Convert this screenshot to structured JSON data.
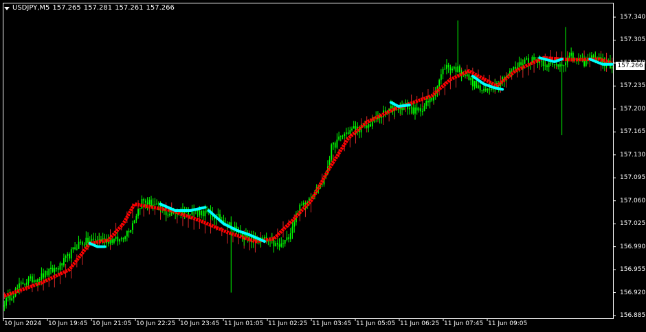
{
  "header": {
    "menu_icon": "triangle-down-icon",
    "symbol_timeframe": "USDJPY,M5",
    "open": "157.265",
    "high": "157.281",
    "low": "157.261",
    "close": "157.266"
  },
  "current_price": "157.266",
  "colors": {
    "background": "#000000",
    "axis": "#ffffff",
    "candle": "#00ff00",
    "ma_up": "#ff0000",
    "ma_down": "#00ffff",
    "ma_fan": "#ff3030"
  },
  "chart_data": {
    "type": "candlestick",
    "symbol": "USDJPY",
    "timeframe": "M5",
    "ylim": [
      156.885,
      157.365
    ],
    "y_ticks": [
      "157.340",
      "157.305",
      "157.270",
      "157.235",
      "157.200",
      "157.165",
      "157.130",
      "157.095",
      "157.060",
      "157.025",
      "156.990",
      "156.955",
      "156.920",
      "156.885"
    ],
    "x_ticks": [
      "10 Jun 2024",
      "10 Jun 19:45",
      "10 Jun 21:05",
      "10 Jun 22:25",
      "10 Jun 23:45",
      "11 Jun 01:05",
      "11 Jun 02:25",
      "11 Jun 03:45",
      "11 Jun 05:05",
      "11 Jun 06:25",
      "11 Jun 07:45",
      "11 Jun 09:05"
    ],
    "close_path": [
      [
        0,
        156.905
      ],
      [
        10,
        156.935
      ],
      [
        20,
        156.945
      ],
      [
        30,
        156.96
      ],
      [
        40,
        156.995
      ],
      [
        48,
        157.0
      ],
      [
        55,
        157.0
      ],
      [
        62,
        157.0
      ],
      [
        68,
        157.02
      ],
      [
        74,
        157.06
      ],
      [
        80,
        157.055
      ],
      [
        88,
        157.04
      ],
      [
        95,
        157.045
      ],
      [
        102,
        157.045
      ],
      [
        110,
        157.04
      ],
      [
        118,
        157.03
      ],
      [
        125,
        157.015
      ],
      [
        132,
        157.0
      ],
      [
        140,
        157.0
      ],
      [
        148,
        156.99
      ],
      [
        152,
        157.0
      ],
      [
        158,
        157.045
      ],
      [
        162,
        157.06
      ],
      [
        167,
        157.075
      ],
      [
        172,
        157.09
      ],
      [
        176,
        157.14
      ],
      [
        182,
        157.16
      ],
      [
        188,
        157.17
      ],
      [
        194,
        157.17
      ],
      [
        200,
        157.185
      ],
      [
        208,
        157.2
      ],
      [
        216,
        157.205
      ],
      [
        222,
        157.195
      ],
      [
        230,
        157.215
      ],
      [
        237,
        157.265
      ],
      [
        245,
        157.26
      ],
      [
        252,
        157.24
      ],
      [
        258,
        157.225
      ],
      [
        265,
        157.24
      ],
      [
        272,
        157.255
      ],
      [
        280,
        157.275
      ],
      [
        287,
        157.275
      ],
      [
        295,
        157.265
      ],
      [
        300,
        157.27
      ],
      [
        305,
        157.28
      ],
      [
        311,
        157.27
      ],
      [
        318,
        157.28
      ],
      [
        323,
        157.27
      ],
      [
        327,
        157.266
      ]
    ],
    "ma_up_path": [
      [
        0,
        156.915
      ],
      [
        20,
        156.935
      ],
      [
        35,
        156.955
      ],
      [
        46,
        156.995
      ],
      [
        56,
        157.0
      ],
      [
        64,
        157.025
      ],
      [
        70,
        157.055
      ],
      [
        80,
        157.05
      ],
      [
        90,
        157.045
      ],
      [
        105,
        157.03
      ],
      [
        120,
        157.012
      ],
      [
        135,
        156.998
      ],
      [
        145,
        157.002
      ],
      [
        155,
        157.03
      ],
      [
        165,
        157.06
      ],
      [
        175,
        157.11
      ],
      [
        185,
        157.155
      ],
      [
        195,
        157.18
      ],
      [
        210,
        157.2
      ],
      [
        220,
        157.21
      ],
      [
        230,
        157.22
      ],
      [
        240,
        157.245
      ],
      [
        250,
        157.258
      ],
      [
        265,
        157.235
      ],
      [
        275,
        157.258
      ],
      [
        290,
        157.278
      ],
      [
        305,
        157.275
      ],
      [
        320,
        157.276
      ],
      [
        327,
        157.27
      ]
    ],
    "ma_down_segments": [
      [
        [
          46,
          156.995
        ],
        [
          50,
          156.99
        ],
        [
          54,
          156.99
        ]
      ],
      [
        [
          84,
          157.055
        ],
        [
          92,
          157.045
        ],
        [
          100,
          157.045
        ],
        [
          108,
          157.05
        ]
      ],
      [
        [
          110,
          157.045
        ],
        [
          118,
          157.025
        ],
        [
          125,
          157.015
        ],
        [
          132,
          157.008
        ],
        [
          140,
          156.998
        ]
      ],
      [
        [
          208,
          157.21
        ],
        [
          212,
          157.204
        ],
        [
          218,
          157.206
        ]
      ],
      [
        [
          252,
          157.25
        ],
        [
          258,
          157.238
        ],
        [
          264,
          157.232
        ],
        [
          268,
          157.23
        ]
      ],
      [
        [
          288,
          157.278
        ],
        [
          296,
          157.272
        ],
        [
          300,
          157.276
        ]
      ],
      [
        [
          315,
          157.276
        ],
        [
          322,
          157.268
        ],
        [
          327,
          157.268
        ]
      ]
    ],
    "spikes": [
      [
        122,
        157.01,
        156.92
      ],
      [
        244,
        157.255,
        157.335
      ],
      [
        300,
        157.265,
        157.16
      ],
      [
        302,
        157.28,
        157.325
      ]
    ]
  }
}
